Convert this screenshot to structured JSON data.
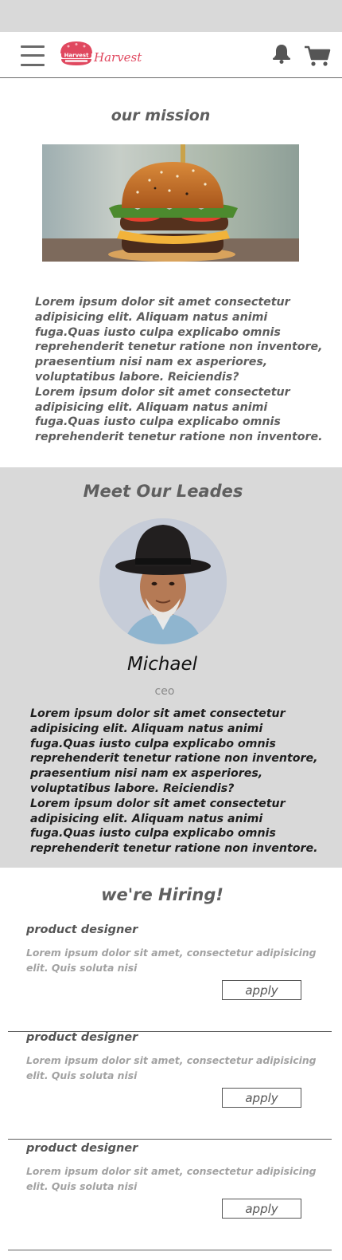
{
  "header": {
    "brand": "Harvest",
    "logo_text": "Harvest"
  },
  "mission": {
    "title": "our mission",
    "text": "Lorem ipsum dolor sit amet consectetur adipisicing elit. Aliquam natus animi fuga.Quas iusto culpa explicabo omnis reprehenderit tenetur ratione non inventore,\n praesentium nisi nam ex asperiores, voluptatibus labore. Reiciendis?\nLorem ipsum dolor sit amet consectetur adipisicing elit. Aliquam natus animi fuga.Quas iusto culpa explicabo omnis reprehenderit tenetur ratione non inventore."
  },
  "leaders": {
    "title": "Meet Our Leades",
    "name": "Michael",
    "role": "ceo",
    "text": "Lorem ipsum dolor sit amet consectetur adipisicing elit. Aliquam natus animi fuga.Quas iusto culpa explicabo omnis reprehenderit tenetur ratione non inventore,\n praesentium nisi nam ex asperiores, voluptatibus labore. Reiciendis?\nLorem ipsum dolor sit amet consectetur adipisicing elit. Aliquam natus animi fuga.Quas iusto culpa explicabo omnis reprehenderit tenetur ratione non inventore."
  },
  "hiring": {
    "title": "we're Hiring!",
    "jobs": [
      {
        "title": "product designer",
        "desc": "Lorem ipsum dolor sit amet, consectetur adipisicing elit. Quis soluta nisi",
        "button": "apply"
      },
      {
        "title": "product designer",
        "desc": "Lorem ipsum dolor sit amet, consectetur adipisicing elit. Quis soluta nisi",
        "button": "apply"
      },
      {
        "title": "product designer",
        "desc": "Lorem ipsum dolor sit amet, consectetur adipisicing elit. Quis soluta nisi",
        "button": "apply"
      }
    ]
  },
  "icons": {
    "menu": "hamburger-menu-icon",
    "notifications": "bell-icon",
    "cart": "shopping-cart-icon"
  },
  "colors": {
    "brand": "#e0485f",
    "section_bg": "#d9d9d9",
    "text": "#5e5e5e"
  }
}
